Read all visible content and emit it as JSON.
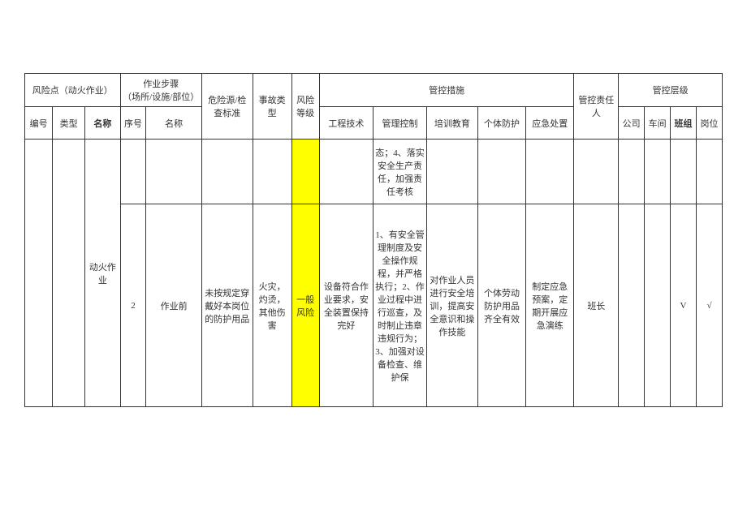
{
  "headers": {
    "risk_point_group": "风险点（动火作业）",
    "step_group": "作业步骤\n（场所/设施/部位）",
    "hazard": "危险源/检查标准",
    "accident_type": "事故类型",
    "risk_level": "风险等级",
    "control_measures_group": "管控措施",
    "responsible": "管控责任人",
    "control_level_group": "管控层级",
    "id": "编号",
    "type": "类型",
    "name": "名称",
    "seq": "序号",
    "step_name": "名称",
    "engineering": "工程技术",
    "management": "管理控制",
    "training": "培训教育",
    "ppe": "个体防护",
    "emergency": "应急处置",
    "company": "公司",
    "workshop": "车间",
    "team": "班组",
    "post": "岗位"
  },
  "rows": {
    "partial": {
      "management": "态；4、落实安全生产责任，加强责任考核"
    },
    "main": {
      "name": "动火作业",
      "seq": "2",
      "step_name": "作业前",
      "hazard": "未按规定穿戴好本岗位的防护用品",
      "accident_type": "火灾，灼烫，其他伤害",
      "risk_level": "一般风险",
      "engineering": "设备符合作业要求，安全装置保持完好",
      "management": "1、有安全管理制度及安全操作规程，并严格执行；2、作业过程中进行巡查，及时制止违章违规行为；3、加强对设备检查、维护保",
      "training": "对作业人员进行安全培训，提高安全意识和操作技能",
      "ppe": "个体劳动防护用品齐全有效",
      "emergency": "制定应急预案，定期开展应急演练",
      "responsible": "班长",
      "company": "",
      "workshop": "",
      "team": "V",
      "post": "√"
    }
  }
}
